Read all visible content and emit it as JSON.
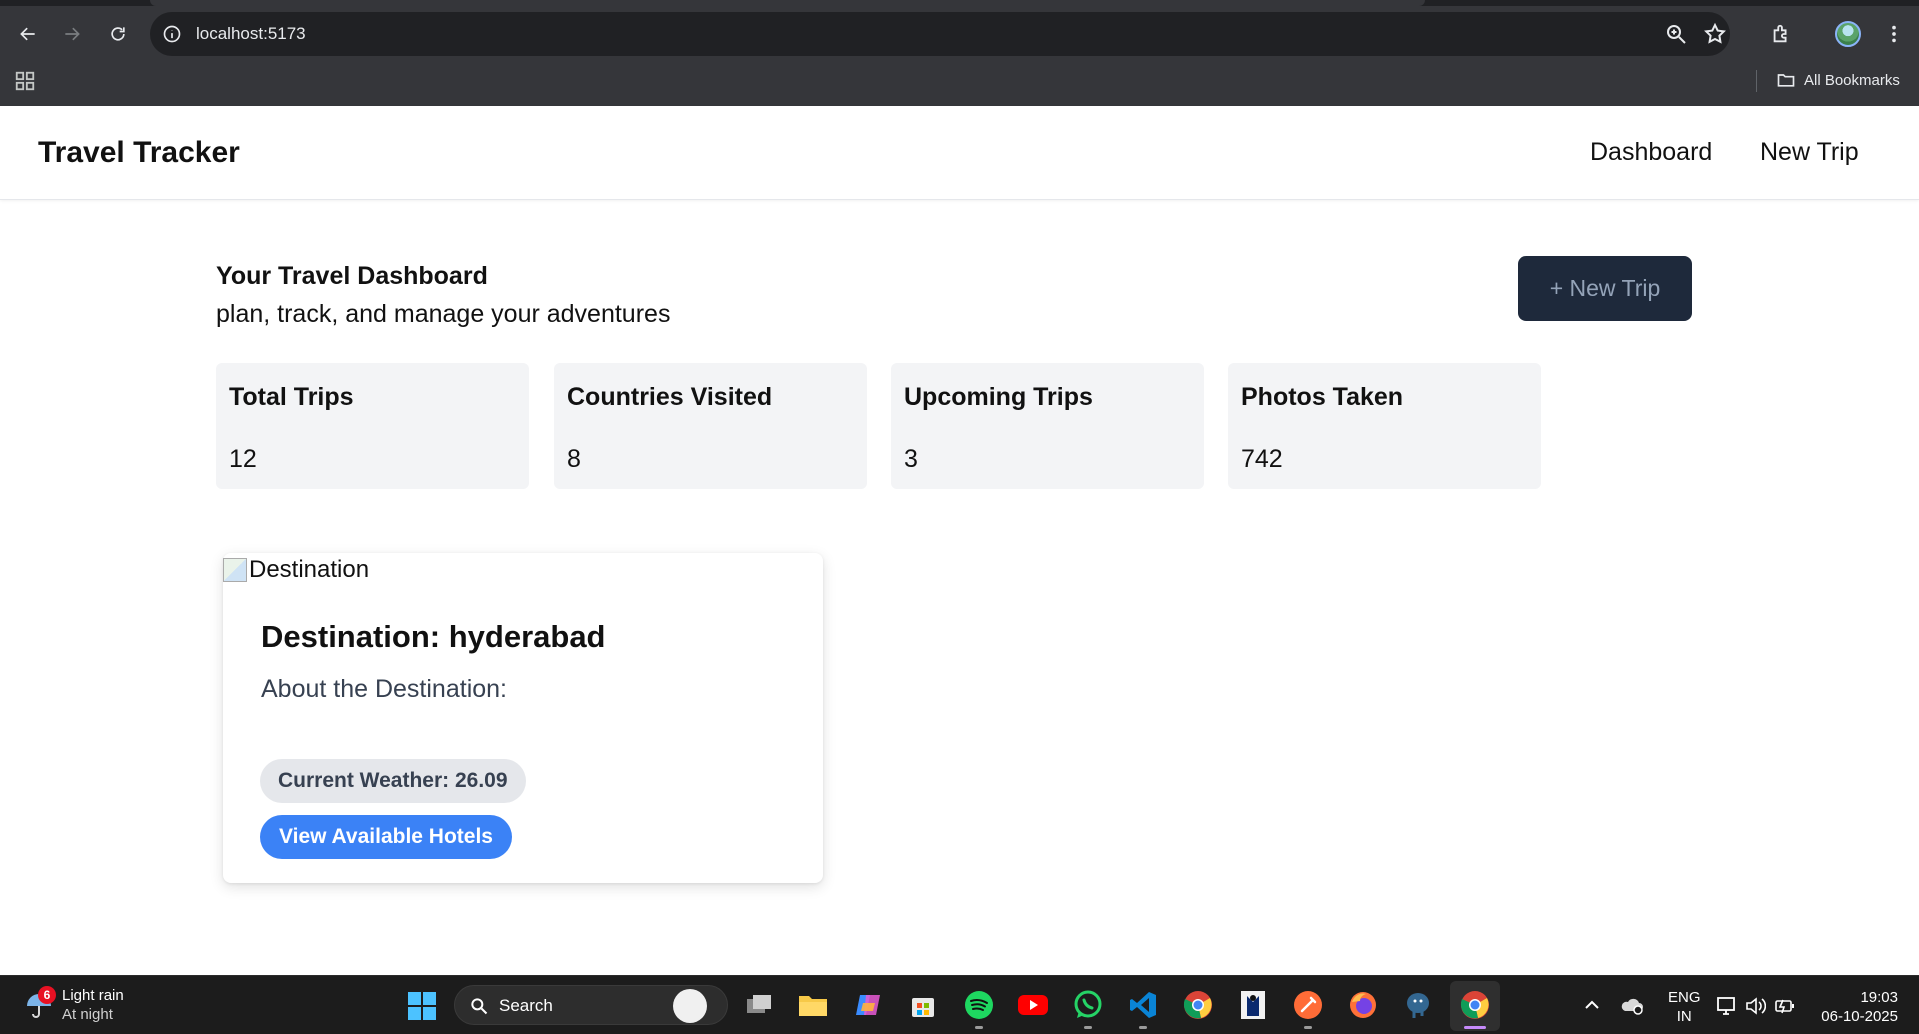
{
  "browser": {
    "url": "localhost:5173",
    "bookmarks_label": "All Bookmarks"
  },
  "app": {
    "brand": "Travel Tracker",
    "nav": [
      "Dashboard",
      "New Trip"
    ]
  },
  "dashboard": {
    "title": "Your Travel Dashboard",
    "subtitle": "plan, track, and manage your adventures",
    "new_trip_button": "+ New Trip",
    "stats": [
      {
        "label": "Total Trips",
        "value": "12"
      },
      {
        "label": "Countries Visited",
        "value": "8"
      },
      {
        "label": "Upcoming Trips",
        "value": "3"
      },
      {
        "label": "Photos Taken",
        "value": "742"
      }
    ]
  },
  "destination_card": {
    "image_alt": "Destination",
    "title": "Destination: hyderabad",
    "about_label": "About the Destination:",
    "weather": "Current Weather: 26.09",
    "hotels_button": "View Available Hotels"
  },
  "taskbar": {
    "weather_badge": "6",
    "weather_title": "Light rain",
    "weather_sub": "At night",
    "search_label": "Search",
    "lang_top": "ENG",
    "lang_bottom": "IN",
    "time": "19:03",
    "date": "06-10-2025"
  },
  "colors": {
    "chrome_bg": "#35363a",
    "omnibox_bg": "#202124",
    "primary_button": "#1e293b",
    "accent_blue": "#3b82f6",
    "stat_card_bg": "#f3f4f6",
    "taskbar_bg": "#1c1c1c"
  }
}
